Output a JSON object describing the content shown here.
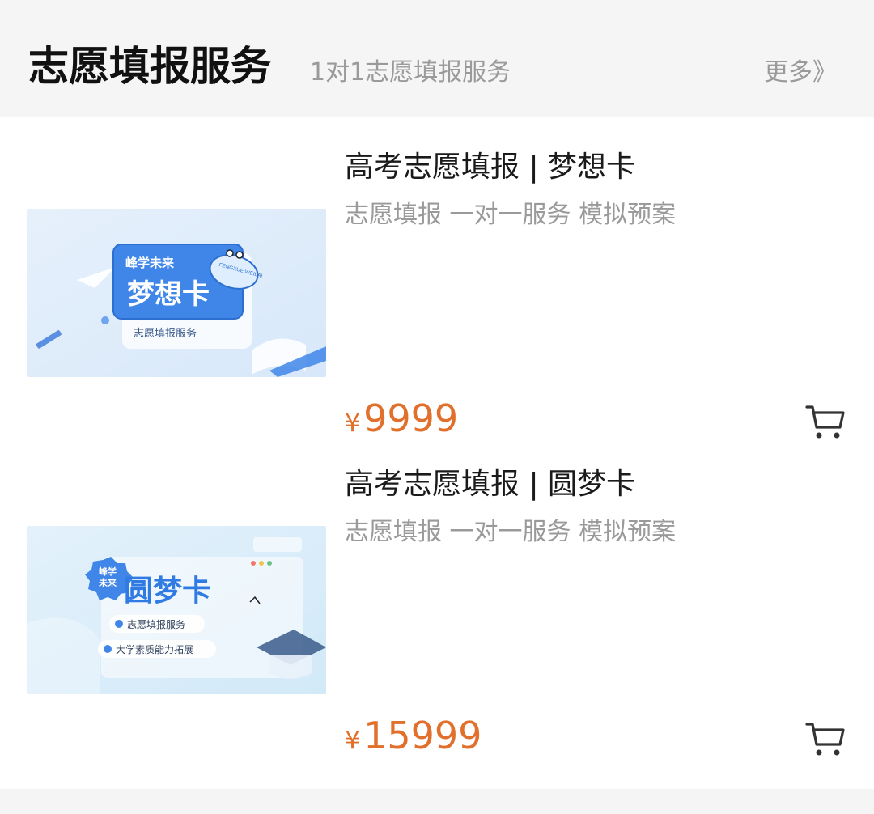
{
  "header": {
    "title": "志愿填报服务",
    "subtitle": "1对1志愿填报服务",
    "more": "更多》"
  },
  "products": [
    {
      "title": "高考志愿填报 | 梦想卡",
      "desc": "志愿填报 一对一服务 模拟预案",
      "currency": "¥",
      "price": "9999",
      "image": {
        "brand": "峰学未来",
        "card_name": "梦想卡",
        "badge": "FENGXUE WEILAI",
        "caption": "志愿填报服务"
      },
      "cart_icon": "cart-icon"
    },
    {
      "title": "高考志愿填报 | 圆梦卡",
      "desc": "志愿填报 一对一服务 模拟预案",
      "currency": "¥",
      "price": "15999",
      "image": {
        "brand_line1": "峰学",
        "brand_line2": "未来",
        "card_name": "圆梦卡",
        "feature1": "志愿填报服务",
        "feature2": "大学素质能力拓展"
      },
      "cart_icon": "cart-icon"
    }
  ],
  "colors": {
    "accent_price": "#e0702b",
    "card_blue": "#3f86e8",
    "background": "#f5f5f5"
  }
}
